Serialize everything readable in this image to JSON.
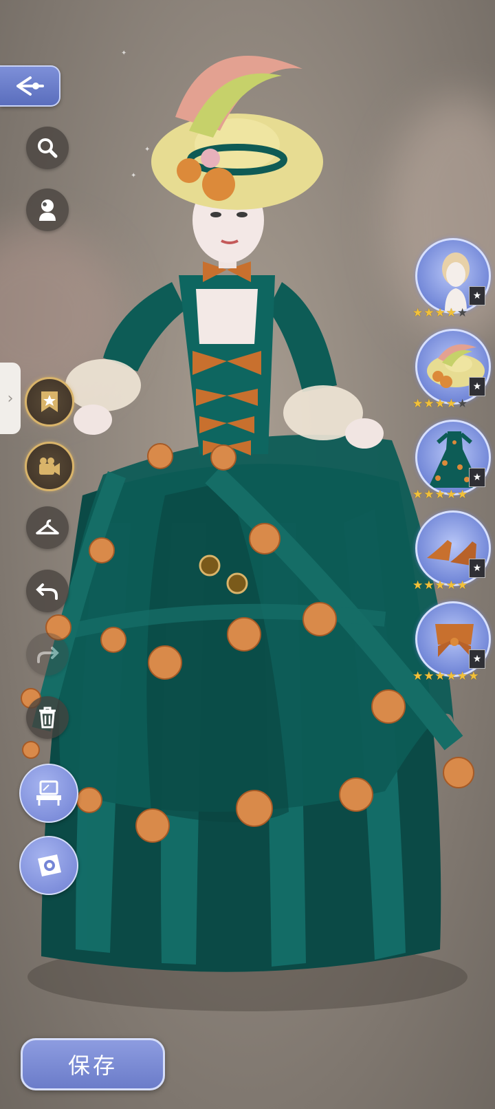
{
  "toolbar": {
    "back_icon": "back-arrow-icon",
    "search_icon": "search-icon",
    "tools": [
      "search-icon",
      "bust-icon",
      "bookmark-star-icon",
      "camera-icon",
      "hanger-icon",
      "undo-icon",
      "redo-icon",
      "trash-icon",
      "vanity-icon",
      "photo-icon"
    ]
  },
  "side_tab": {
    "chevron": "›"
  },
  "outfit_slots": [
    {
      "name": "hair",
      "stars_filled": 4,
      "stars_total": 5,
      "badge": "★"
    },
    {
      "name": "hat",
      "stars_filled": 4,
      "stars_total": 5,
      "badge": "★"
    },
    {
      "name": "dress",
      "stars_filled": 5,
      "stars_total": 5,
      "badge": "★"
    },
    {
      "name": "shoes",
      "stars_filled": 5,
      "stars_total": 5,
      "badge": "★"
    },
    {
      "name": "accessory",
      "stars_filled": 6,
      "stars_total": 6,
      "badge": "★"
    }
  ],
  "save_button": {
    "label": "保存"
  },
  "colors": {
    "accent_blue": "#6f80d3",
    "gold": "#d9b46a",
    "dress_teal": "#0e5a55",
    "trim_orange": "#c8702e"
  }
}
